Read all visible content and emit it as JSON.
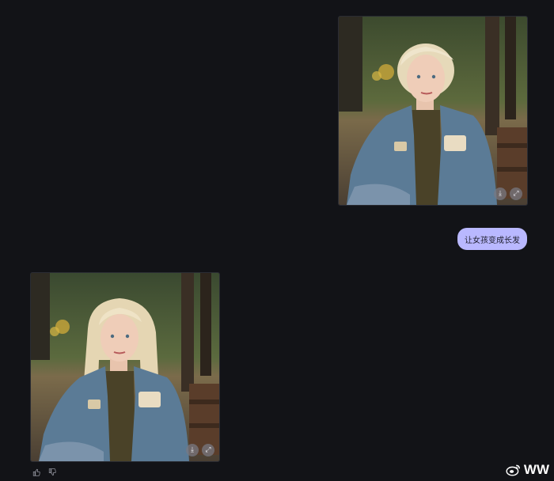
{
  "conversation": {
    "user_image": {
      "alt": "短发金发女孩坐在公园长椅上",
      "actions": [
        {
          "icon": "download-icon"
        },
        {
          "icon": "expand-icon"
        }
      ]
    },
    "user_message": "让女孩变成长发",
    "assistant_image": {
      "alt": "长发金发女孩坐在公园长椅上",
      "actions": [
        {
          "icon": "download-icon"
        },
        {
          "icon": "expand-icon"
        }
      ]
    },
    "feedback": [
      {
        "icon": "thumbs-up-icon"
      },
      {
        "icon": "thumbs-down-icon"
      }
    ]
  },
  "watermark": {
    "logo": "weibo-icon",
    "text": "WW"
  },
  "colors": {
    "background": "#121317",
    "bubble": "#b9b8ff",
    "jacket": "#5b7b96"
  }
}
